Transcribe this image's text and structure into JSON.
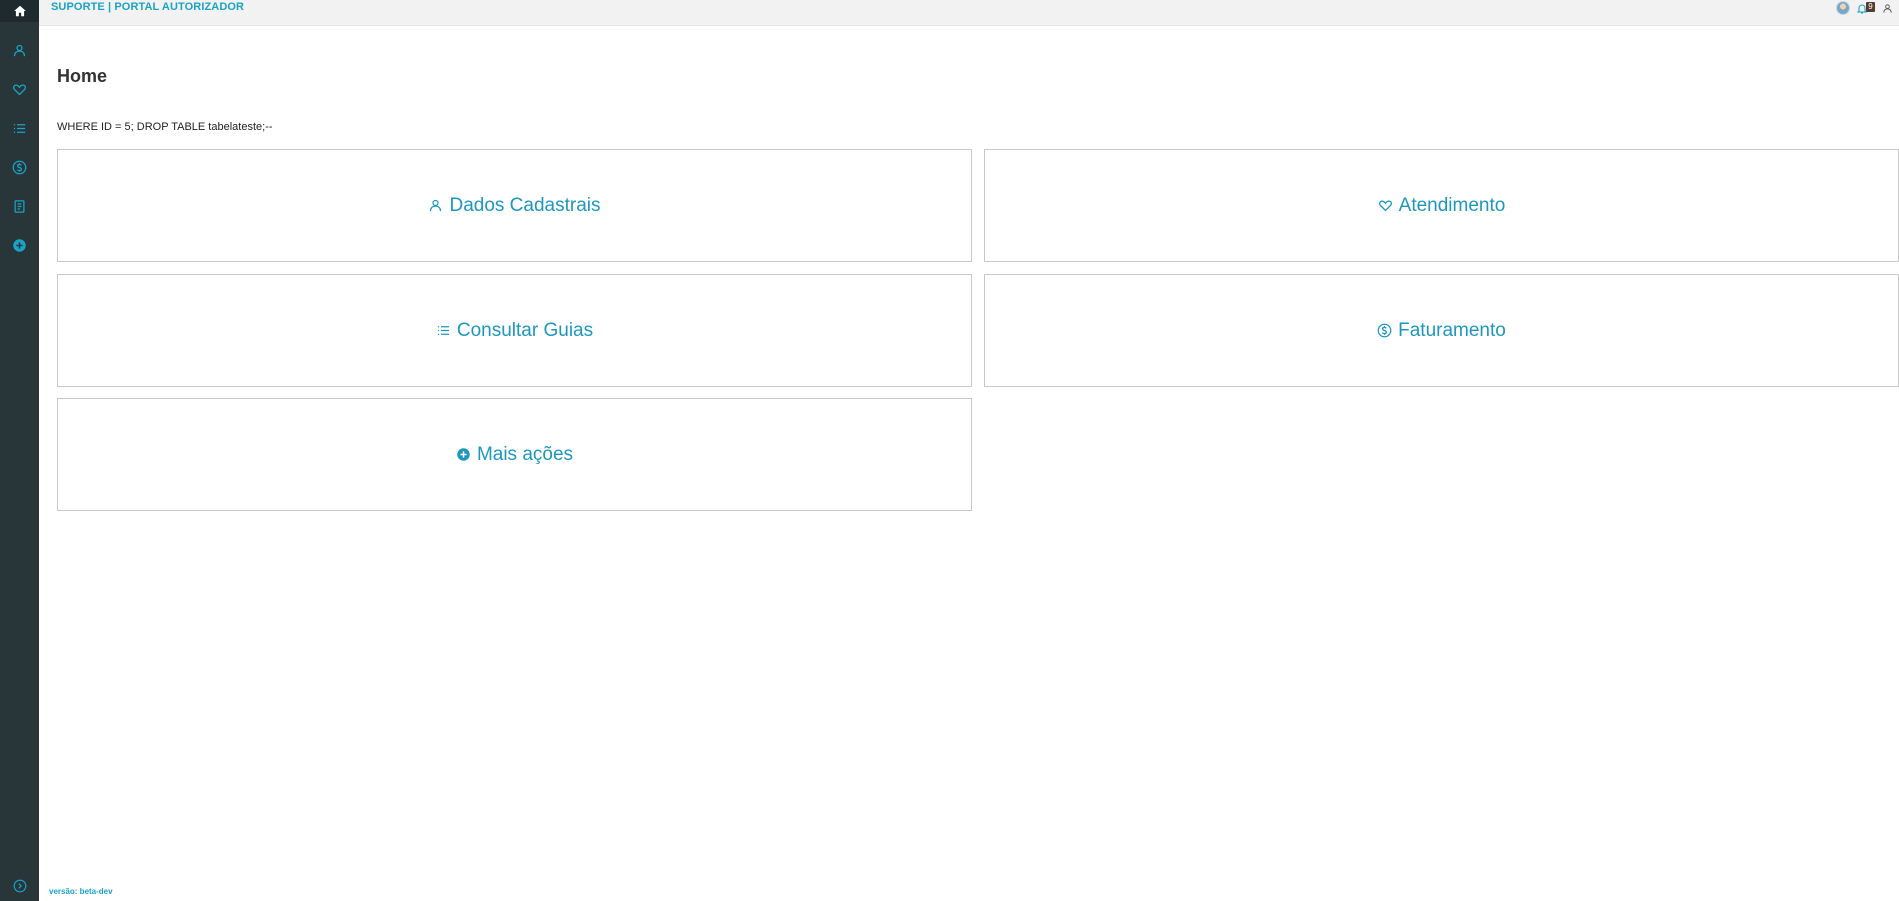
{
  "header": {
    "app_title": "SUPORTE | PORTAL AUTORIZADOR",
    "notification_count": "9"
  },
  "main": {
    "page_title": "Home",
    "sql_text": "WHERE ID = 5; DROP TABLE tabelateste;--",
    "cards": [
      {
        "label": "Dados Cadastrais",
        "icon": "user-icon"
      },
      {
        "label": "Atendimento",
        "icon": "heart-icon"
      },
      {
        "label": "Consultar Guias",
        "icon": "list-icon"
      },
      {
        "label": "Faturamento",
        "icon": "dollar-circle-icon"
      },
      {
        "label": "Mais ações",
        "icon": "plus-circle-icon"
      }
    ]
  },
  "sidebar": {
    "items": [
      {
        "icon": "home-icon"
      },
      {
        "icon": "user-icon"
      },
      {
        "icon": "heart-icon"
      },
      {
        "icon": "list-icon"
      },
      {
        "icon": "dollar-circle-icon"
      },
      {
        "icon": "document-icon"
      },
      {
        "icon": "plus-circle-icon"
      }
    ]
  },
  "footer": {
    "version": "versão: beta-dev"
  },
  "colors": {
    "accent": "#1e97bd",
    "sidebar": "#28363a",
    "topbar": "#f2f2f2"
  }
}
